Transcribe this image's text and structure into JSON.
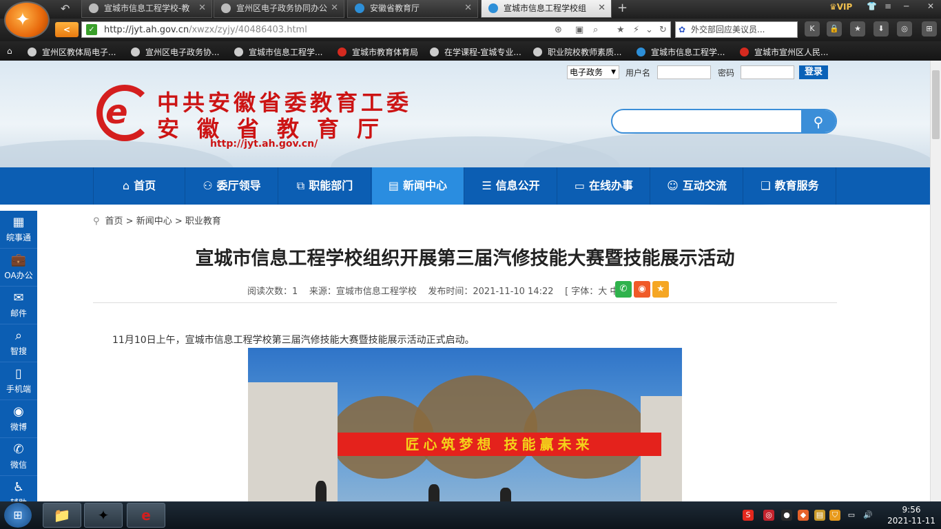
{
  "browser": {
    "tabs": [
      {
        "label": "宣城市信息工程学校-教",
        "active": false
      },
      {
        "label": "宣州区电子政务协同办公",
        "active": false
      },
      {
        "label": "安徽省教育厅",
        "active": false
      },
      {
        "label": "宣城市信息工程学校组",
        "active": true
      }
    ],
    "vip_label": "VIP",
    "url_prefix": "http://jyt.ah.gov.cn",
    "url_path": "/xwzx/zyjy/40486403.html",
    "search_text": "外交部回应美议员...",
    "bookmarks": [
      "宣州区教体局电子...",
      "宣州区电子政务协...",
      "宣城市信息工程学...",
      "宣城市教育体育局",
      "在学课程-宣城专业...",
      "职业院校教师素质...",
      "宣城市信息工程学...",
      "宣城市宣州区人民..."
    ]
  },
  "header": {
    "login_select": "电子政务",
    "username_label": "用户名",
    "password_label": "密码",
    "login_button": "登录",
    "title_line1": "中共安徽省委教育工委",
    "title_line2": "安徽省教育厅",
    "site_url": "http://jyt.ah.gov.cn/"
  },
  "nav": [
    {
      "label": "首页",
      "icon": "home-icon"
    },
    {
      "label": "委厅领导",
      "icon": "people-icon"
    },
    {
      "label": "职能部门",
      "icon": "org-icon"
    },
    {
      "label": "新闻中心",
      "icon": "news-icon",
      "active": true
    },
    {
      "label": "信息公开",
      "icon": "doc-icon"
    },
    {
      "label": "在线办事",
      "icon": "monitor-icon"
    },
    {
      "label": "互动交流",
      "icon": "chat-icon"
    },
    {
      "label": "教育服务",
      "icon": "book-icon"
    }
  ],
  "sidebar": [
    "皖事通",
    "OA办公",
    "邮件",
    "智搜",
    "手机端",
    "微博",
    "微信",
    "辅助"
  ],
  "breadcrumb": [
    "首页",
    "新闻中心",
    "职业教育"
  ],
  "article": {
    "title": "宣城市信息工程学校组织开展第三届汽修技能大赛暨技能展示活动",
    "reads_label": "阅读次数：",
    "reads": "1",
    "source": "来源：宣城市信息工程学校",
    "published": "发布时间：2021-11-10 14:22",
    "font_size": "[ 字体：大 中 小 ]",
    "lead": "11月10日上午，宣城市信息工程学校第三届汽修技能大赛暨技能展示活动正式启动。",
    "photo_banner": "匠心筑梦想  技能赢未来"
  },
  "taskbar": {
    "time": "9:56",
    "date": "2021-11-11"
  },
  "colors": {
    "nav_bg": "#0c5eb3",
    "nav_active": "#2a8de0",
    "brand_red": "#cc1414"
  }
}
